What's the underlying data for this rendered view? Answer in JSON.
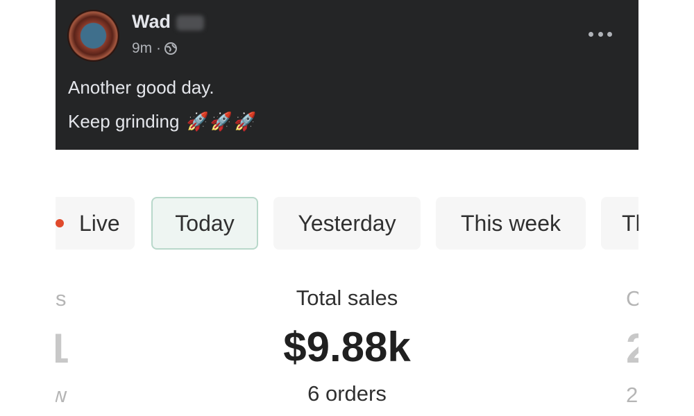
{
  "post": {
    "author": "Wad",
    "time": "9m ·",
    "line1": "Another good day.",
    "line2": "Keep grinding",
    "emojis": [
      "🚀",
      "🚀",
      "🚀"
    ]
  },
  "tabs": {
    "live": "Live",
    "today": "Today",
    "yesterday": "Yesterday",
    "this_week": "This week",
    "partial": "Th"
  },
  "metrics": {
    "left_label_fragment": "s",
    "left_value_fragment": "1",
    "left_sub_fragment": "w",
    "center_label": "Total sales",
    "center_value": "$9.88k",
    "center_sub": "6 orders",
    "right_label_fragment": "C",
    "right_value_fragment": "2",
    "right_sub_fragment": "2"
  },
  "colors": {
    "post_bg": "#242526",
    "active_tab_bg": "#eef5f2",
    "active_tab_border": "#b8d8ca",
    "live_dot": "#e04a2c"
  }
}
